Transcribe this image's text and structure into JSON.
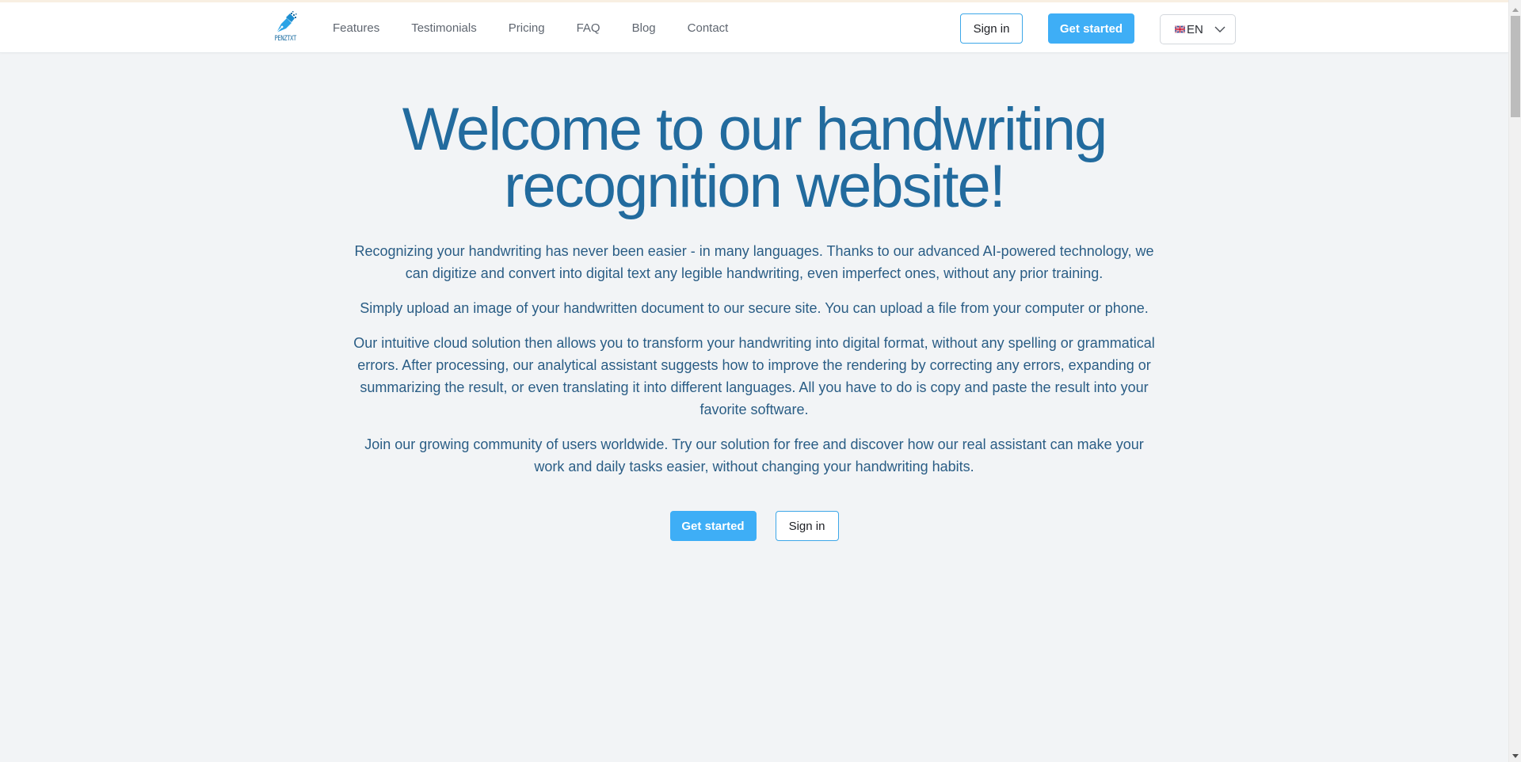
{
  "brand": {
    "name": "PENZTXT",
    "accent_color": "#3eaef6",
    "heading_color": "#226b9e",
    "text_color": "#2a5d85"
  },
  "nav": {
    "links": [
      {
        "label": "Features"
      },
      {
        "label": "Testimonials"
      },
      {
        "label": "Pricing"
      },
      {
        "label": "FAQ"
      },
      {
        "label": "Blog"
      },
      {
        "label": "Contact"
      }
    ],
    "sign_in_label": "Sign in",
    "get_started_label": "Get started",
    "language": {
      "selected": "EN",
      "flag_icon": "uk-flag-icon",
      "dropdown_icon": "chevron-down-icon"
    }
  },
  "hero": {
    "title": "Welcome to our handwriting recognition website!",
    "paragraphs": [
      "Recognizing your handwriting has never been easier - in many languages. Thanks to our advanced AI-powered technology, we can digitize and convert into digital text any legible handwriting, even imperfect ones, without any prior training.",
      "Simply upload an image of your handwritten document to our secure site. You can upload a file from your computer or phone.",
      "Our intuitive cloud solution then allows you to transform your handwriting into digital format, without any spelling or grammatical errors. After processing, our analytical assistant suggests how to improve the rendering by correcting any errors, expanding or summarizing the result, or even translating it into different languages. All you have to do is copy and paste the result into your favorite software.",
      "Join our growing community of users worldwide. Try our solution for free and discover how our real assistant can make your work and daily tasks easier, without changing your handwriting habits."
    ],
    "get_started_label": "Get started",
    "sign_in_label": "Sign in"
  }
}
